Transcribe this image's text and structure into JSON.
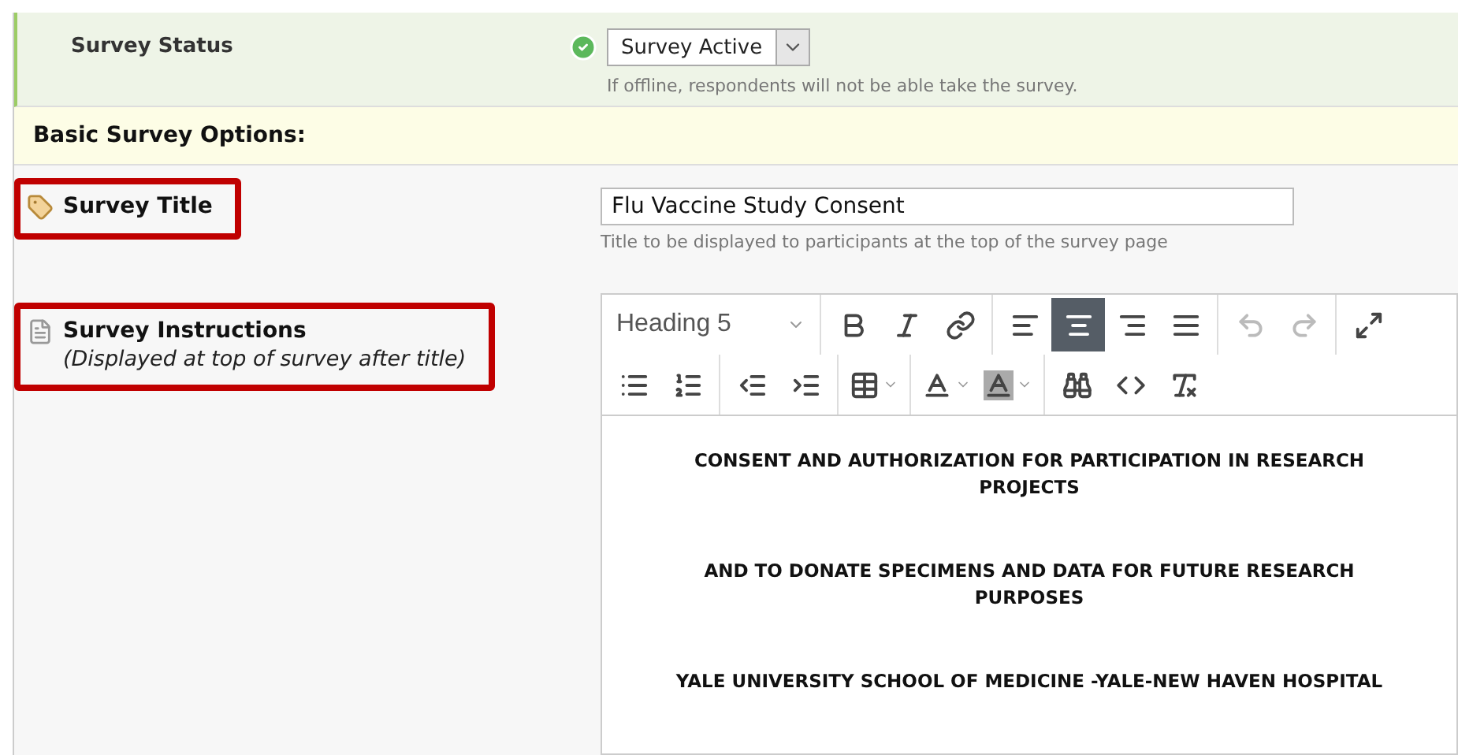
{
  "survey_status": {
    "label": "Survey Status",
    "ok": true,
    "select_value": "Survey Active",
    "help": "If offline, respondents will not be able take the survey."
  },
  "section_header": "Basic Survey Options:",
  "survey_title": {
    "label": "Survey Title",
    "highlighted": true,
    "value": "Flu Vaccine Study Consent",
    "help": "Title to be displayed to participants at the top of the survey page"
  },
  "survey_instructions": {
    "label": "Survey Instructions",
    "note": "(Displayed at top of survey after title)",
    "highlighted": true
  },
  "editor": {
    "format_select": "Heading 5",
    "toolbar_rows": [
      [
        [
          {
            "kind": "bold",
            "selected": false,
            "disabled": false
          },
          {
            "kind": "italic",
            "selected": false,
            "disabled": false
          },
          {
            "kind": "link",
            "selected": false,
            "disabled": false
          }
        ],
        [
          {
            "kind": "align-left",
            "selected": false,
            "disabled": false
          },
          {
            "kind": "align-center",
            "selected": true,
            "disabled": false
          },
          {
            "kind": "align-right",
            "selected": false,
            "disabled": false
          },
          {
            "kind": "align-justify",
            "selected": false,
            "disabled": false
          }
        ],
        [
          {
            "kind": "undo",
            "selected": false,
            "disabled": true
          },
          {
            "kind": "redo",
            "selected": false,
            "disabled": true
          }
        ],
        [
          {
            "kind": "fullscreen",
            "selected": false,
            "disabled": false
          }
        ]
      ],
      [
        [
          {
            "kind": "bullet-list",
            "selected": false,
            "disabled": false
          },
          {
            "kind": "numbered-list",
            "selected": false,
            "disabled": false
          }
        ],
        [
          {
            "kind": "outdent",
            "selected": false,
            "disabled": false
          },
          {
            "kind": "indent",
            "selected": false,
            "disabled": false
          }
        ],
        [
          {
            "kind": "table",
            "selected": false,
            "disabled": false
          }
        ],
        [
          {
            "kind": "text-color",
            "selected": false,
            "disabled": false
          },
          {
            "kind": "background-color",
            "selected": false,
            "disabled": false
          }
        ],
        [
          {
            "kind": "find",
            "selected": false,
            "disabled": false
          },
          {
            "kind": "source-code",
            "selected": false,
            "disabled": false
          },
          {
            "kind": "clear-formatting",
            "selected": false,
            "disabled": false
          }
        ]
      ]
    ],
    "paragraphs": [
      "CONSENT AND AUTHORIZATION FOR PARTICIPATION IN RESEARCH PROJECTS",
      "AND TO DONATE SPECIMENS AND DATA FOR FUTURE RESEARCH PURPOSES",
      "YALE UNIVERSITY SCHOOL OF MEDICINE -YALE-NEW HAVEN HOSPITAL"
    ]
  }
}
